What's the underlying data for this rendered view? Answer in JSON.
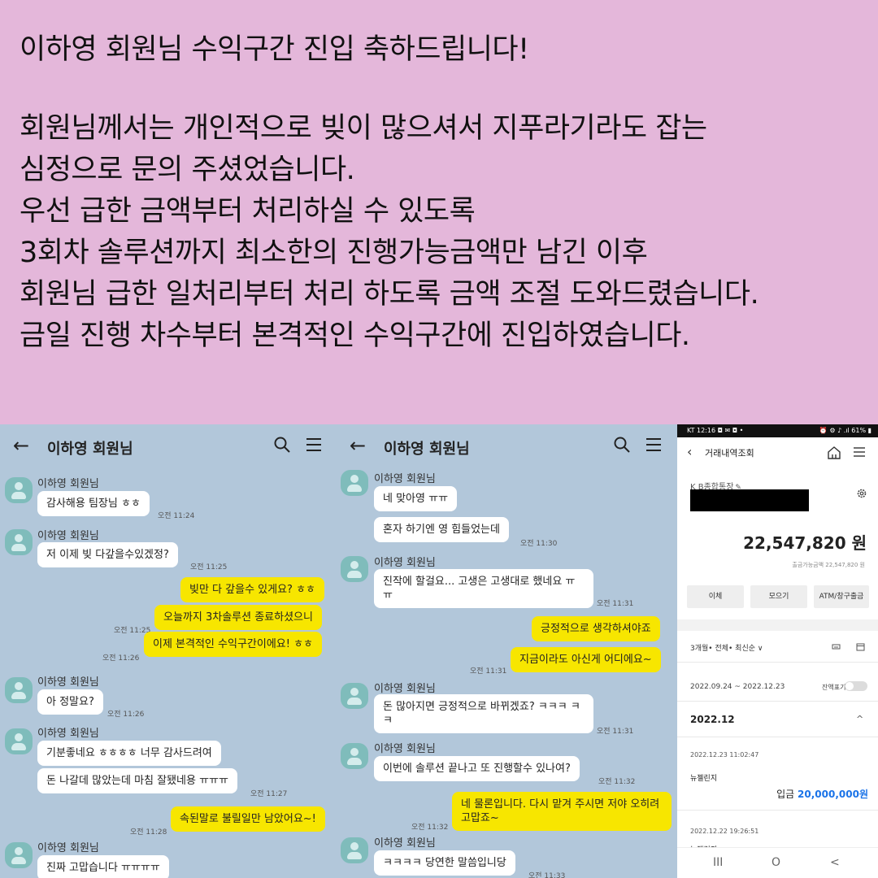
{
  "header": {
    "title": "이하영 회원님 수익구간 진입 축하드립니다!",
    "lines": [
      "회원님께서는 개인적으로 빚이 많으셔서 지푸라기라도 잡는",
      "심정으로 문의 주셨었습니다.",
      "우선 급한 금액부터 처리하실 수 있도록",
      "3회차 솔루션까지 최소한의 진행가능금액만 남긴 이후",
      "회원님 급한 일처리부터 처리 하도록 금액 조절 도와드렸습니다.",
      "금일 진행 차수부터 본격적인 수익구간에 진입하였습니다."
    ]
  },
  "chat1": {
    "title": "이하영 회원님",
    "sender": "이하영 회원님",
    "msgs": [
      "감사해용 팀장님 ㅎㅎ",
      "저 이제 빚 다갚을수있겠정?",
      "빚만 다 갚을수 있게요? ㅎㅎ",
      "오늘까지 3차솔루션 종료하셨으니",
      "이제 본격적인 수익구간이에요! ㅎㅎ",
      "아 정말요?",
      "기분좋네요 ㅎㅎㅎㅎ 너무 감사드려여",
      "돈 나갈데 많았는데 마침 잘됐네용 ㅠㅠㅠ",
      "속된말로 불릴일만 남았어요~!",
      "진짜 고맙습니다 ㅠㅠㅠㅠ"
    ],
    "times": [
      "오전 11:24",
      "오전 11:25",
      "오전 11:25",
      "오전 11:26",
      "오전 11:26",
      "오전 11:27",
      "오전 11:28"
    ]
  },
  "chat2": {
    "title": "이하영 회원님",
    "sender": "이하영 회원님",
    "msgs": [
      "네 맞아영 ㅠㅠ",
      "혼자 하기엔 영 힘들었는데",
      "진작에 할걸요... 고생은 고생대로 했네요 ㅠㅠ",
      "긍정적으로 생각하셔야죠",
      "지금이라도 아신게 어디에요~",
      "돈 많아지면 긍정적으로 바뀌겠죠? ㅋㅋㅋ ㅋㅋ",
      "이번에 솔루션 끝나고 또 진행할수 있나여?",
      "네 물론입니다. 다시 맡겨 주시면 저야 오히려 고맙죠~",
      "ㅋㅋㅋㅋ 당연한 말씀입니당"
    ],
    "times": [
      "오전 11:30",
      "오전 11:31",
      "오전 11:31",
      "오전 11:31",
      "오전 11:32",
      "오전 11:32",
      "오전 11:33"
    ]
  },
  "bank": {
    "status_left": "KT 12:16 ◘ ✉ ◘ •",
    "status_right": "⏰ ⚙ ♪ .ıl 61% ▮",
    "nav_title": "거래내역조회",
    "account_name": "K B종합통장",
    "balance": "22,547,820 원",
    "available": "출금가능금액 22,547,820 원",
    "buttons": [
      "이체",
      "모으기",
      "ATM/창구출금"
    ],
    "filter": "3개월• 전체• 최신순 ∨",
    "range": "2022.09.24 ~ 2022.12.23",
    "toggle_label": "잔액표기",
    "month": "2022.12",
    "tx1": {
      "date": "2022.12.23 11:02:47",
      "name": "뉴젤린지",
      "type": "입금",
      "amount": "20,000,000원"
    },
    "tx2": {
      "date": "2022.12.22 19:26:51",
      "name": "뉴젤린지"
    },
    "nav_buttons": [
      "III",
      "O",
      "<"
    ]
  },
  "colors": {
    "header_bg": "#e4b7da",
    "chat_bg": "#b2c7da",
    "bubble_mine": "#f7e600",
    "bubble_other": "#ffffff",
    "amount_blue": "#1a73e8"
  }
}
